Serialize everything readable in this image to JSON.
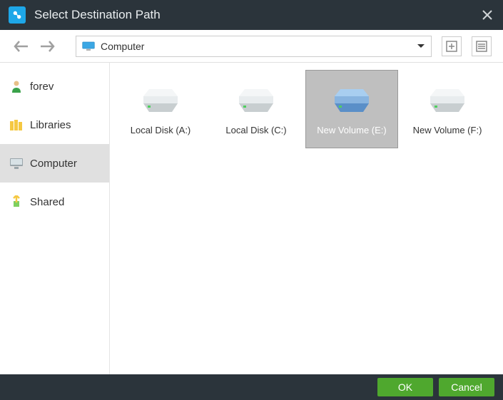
{
  "window": {
    "title": "Select Destination Path"
  },
  "toolbar": {
    "path_label": "Computer"
  },
  "sidebar": {
    "items": [
      {
        "label": "forev"
      },
      {
        "label": "Libraries"
      },
      {
        "label": "Computer"
      },
      {
        "label": "Shared"
      }
    ]
  },
  "drives": [
    {
      "label": "Local Disk (A:)"
    },
    {
      "label": "Local Disk (C:)"
    },
    {
      "label": "New Volume (E:)"
    },
    {
      "label": "New Volume (F:)"
    }
  ],
  "footer": {
    "ok_label": "OK",
    "cancel_label": "Cancel"
  }
}
